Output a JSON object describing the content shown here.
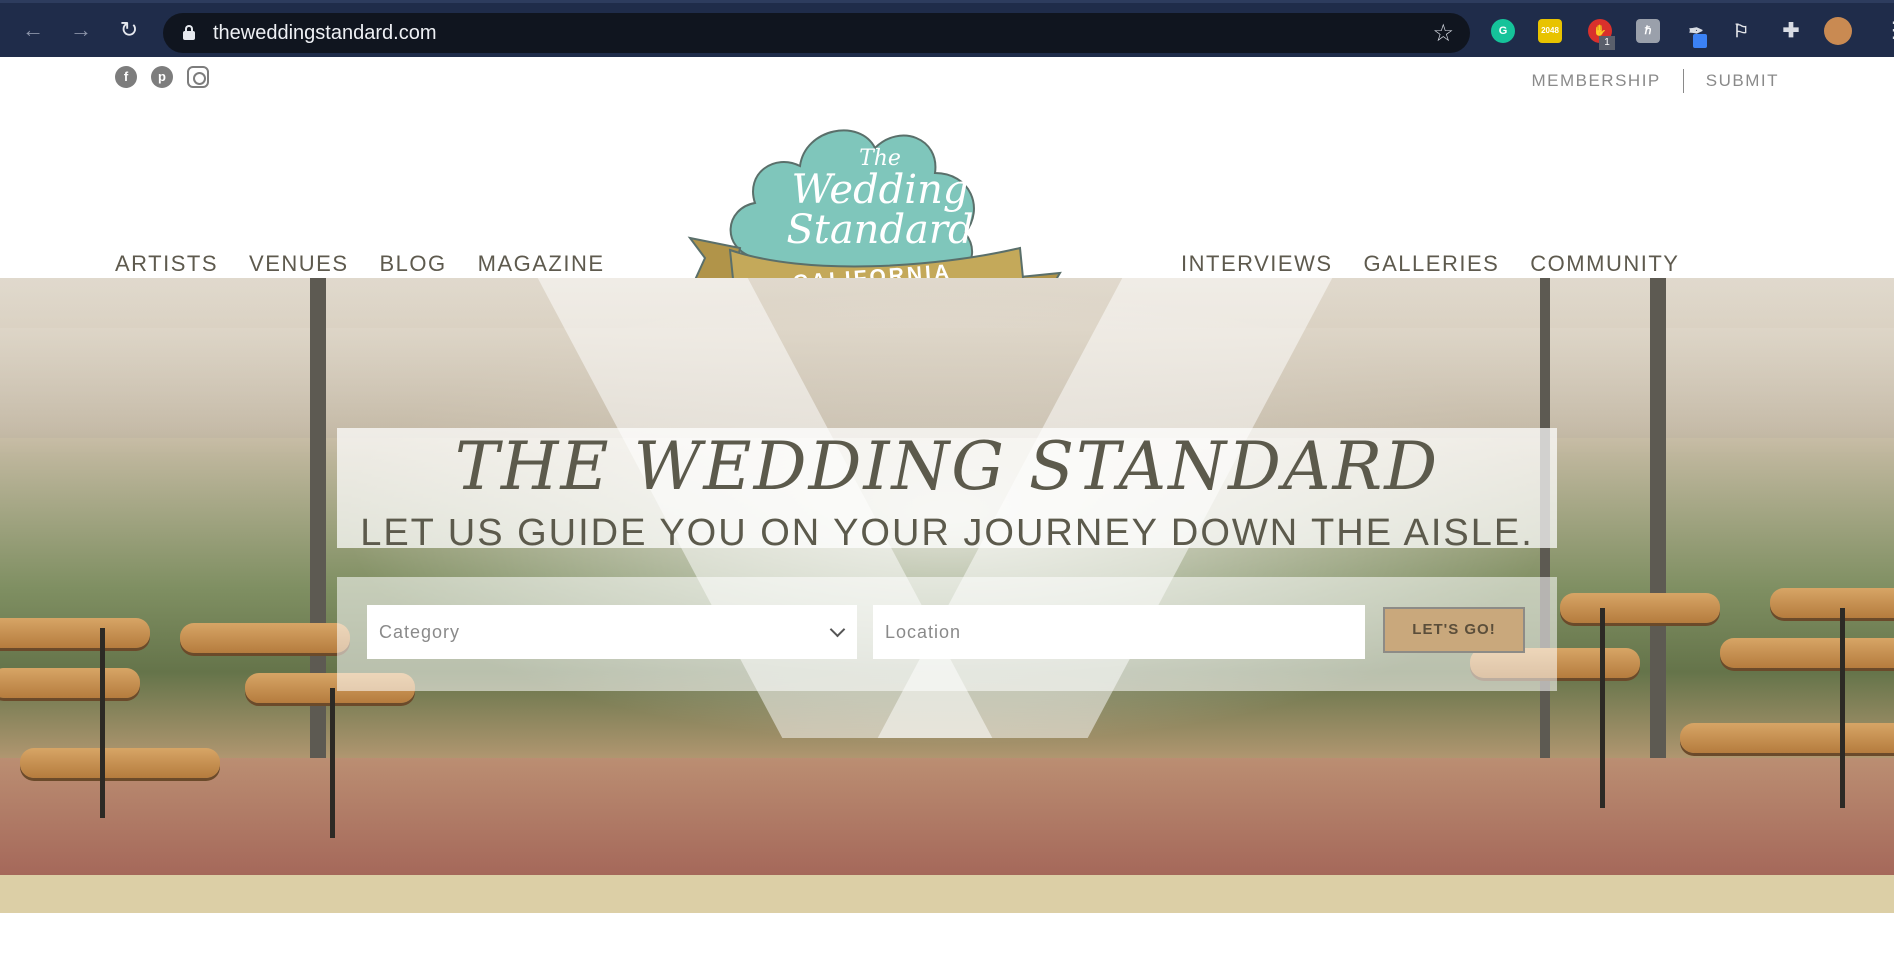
{
  "browser": {
    "url": "theweddingstandard.com",
    "extension_badge": "1",
    "extensions": [
      "grammarly-icon",
      "2048-icon",
      "adblock-icon",
      "tag-icon",
      "pen-icon",
      "shoe-icon",
      "puzzle-icon",
      "profile-avatar"
    ]
  },
  "header": {
    "social": [
      "facebook-icon",
      "pinterest-icon",
      "instagram-icon"
    ],
    "top_links": [
      "MEMBERSHIP",
      "SUBMIT"
    ],
    "nav_left": [
      "ARTISTS",
      "VENUES",
      "BLOG",
      "MAGAZINE"
    ],
    "nav_right": [
      "INTERVIEWS",
      "GALLERIES",
      "COMMUNITY"
    ],
    "logo": {
      "the": "The",
      "wedding": "Wedding",
      "standard": "Standard",
      "california": "CALIFORNIA"
    }
  },
  "hero": {
    "title": "THE WEDDING STANDARD",
    "subtitle": "LET US GUIDE YOU ON YOUR JOURNEY DOWN THE AISLE.",
    "search": {
      "category_placeholder": "Category",
      "location_placeholder": "Location",
      "button_label": "LET'S GO!"
    }
  },
  "colors": {
    "browser_bg": "#1f2c4a",
    "nav_text": "#5e5a4e",
    "logo_teal": "#7fc6bb",
    "logo_gold": "#c4a95a",
    "button_bg": "#c9a87c",
    "footer_band": "#dccfa6"
  }
}
